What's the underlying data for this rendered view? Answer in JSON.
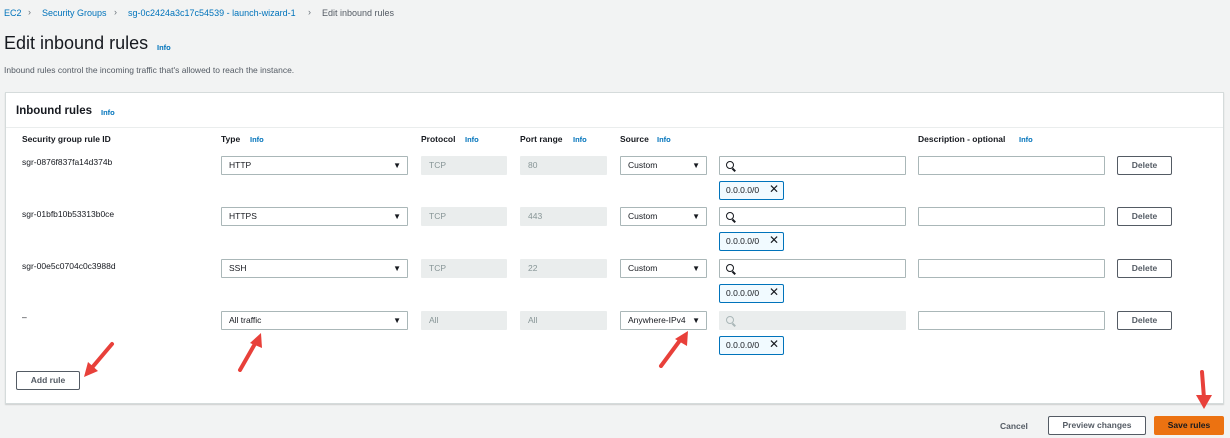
{
  "breadcrumb": {
    "items": [
      "EC2",
      "Security Groups",
      "sg-0c2424a3c17c54539 - launch-wizard-1",
      "Edit inbound rules"
    ]
  },
  "page": {
    "title": "Edit inbound rules",
    "info": "Info",
    "description": "Inbound rules control the incoming traffic that's allowed to reach the instance."
  },
  "panel": {
    "title": "Inbound rules",
    "info": "Info"
  },
  "columns": {
    "rule_id": "Security group rule ID",
    "type": "Type",
    "protocol": "Protocol",
    "port_range": "Port range",
    "source": "Source",
    "description": "Description - optional",
    "info": "Info"
  },
  "rules": [
    {
      "id": "sgr-0876f837fa14d374b",
      "type": "HTTP",
      "protocol": "TCP",
      "port": "80",
      "source": "Custom",
      "search": "",
      "cidr": "0.0.0.0/0",
      "description": "",
      "delete": "Delete"
    },
    {
      "id": "sgr-01bfb10b53313b0ce",
      "type": "HTTPS",
      "protocol": "TCP",
      "port": "443",
      "source": "Custom",
      "search": "",
      "cidr": "0.0.0.0/0",
      "description": "",
      "delete": "Delete"
    },
    {
      "id": "sgr-00e5c0704c0c3988d",
      "type": "SSH",
      "protocol": "TCP",
      "port": "22",
      "source": "Custom",
      "search": "",
      "cidr": "0.0.0.0/0",
      "description": "",
      "delete": "Delete"
    },
    {
      "id": "–",
      "type": "All traffic",
      "protocol": "All",
      "port": "All",
      "source": "Anywhere-IPv4",
      "search": "",
      "cidr": "0.0.0.0/0",
      "description": "",
      "delete": "Delete"
    }
  ],
  "actions": {
    "add_rule": "Add rule",
    "cancel": "Cancel",
    "preview": "Preview changes",
    "save": "Save rules"
  },
  "colors": {
    "link": "#0073bb",
    "primary": "#ec7211",
    "annotation_arrow": "#e8403a"
  }
}
